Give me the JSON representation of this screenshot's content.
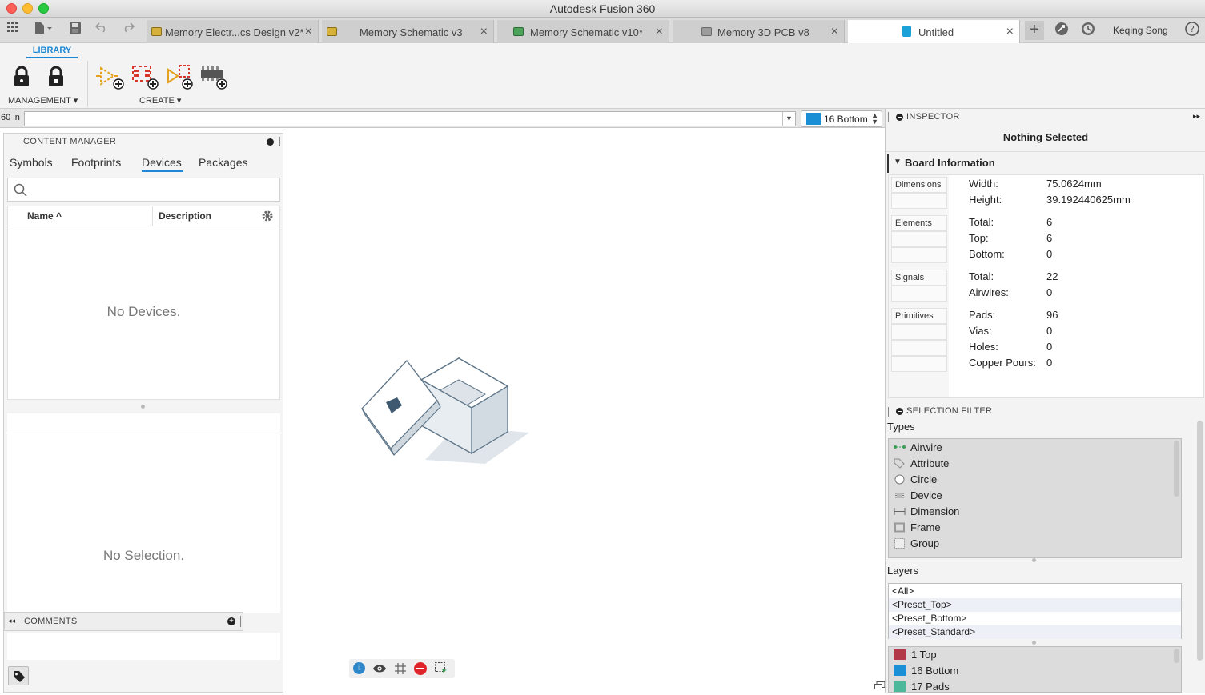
{
  "window": {
    "title": "Autodesk Fusion 360"
  },
  "tabs": [
    {
      "label": "Memory Electr...cs Design v2*",
      "color": "#d6b13a"
    },
    {
      "label": "Memory Schematic v3",
      "color": "#d6b13a"
    },
    {
      "label": "Memory Schematic v10*",
      "color": "#4ea35a"
    },
    {
      "label": "Memory 3D PCB v8",
      "color": "#9c9c9c"
    },
    {
      "label": "Untitled",
      "color": "#1aa1d8"
    }
  ],
  "user": {
    "name": "Keqing Song"
  },
  "ribbon": {
    "tab": "LIBRARY",
    "management_label": "MANAGEMENT",
    "create_label": "CREATE"
  },
  "cmdbar": {
    "grid_readout": "60 in",
    "layer_value": "16 Bottom",
    "layer_color": "#1a8fd6"
  },
  "content_manager": {
    "title": "CONTENT MANAGER",
    "tabs": [
      "Symbols",
      "Footprints",
      "Devices",
      "Packages"
    ],
    "active_tab": "Devices",
    "search_placeholder": "",
    "columns": {
      "name": "Name",
      "description": "Description"
    },
    "empty_list": "No Devices.",
    "empty_preview": "No Selection.",
    "comments_title": "COMMENTS"
  },
  "inspector": {
    "title": "INSPECTOR",
    "status": "Nothing Selected",
    "section": "Board Information",
    "categories": [
      "Dimensions",
      "Elements",
      "Signals",
      "Primitives"
    ],
    "dimensions": {
      "width_key": "Width:",
      "width": "75.0624mm",
      "height_key": "Height:",
      "height": "39.192440625mm"
    },
    "elements": {
      "total_key": "Total:",
      "total": "6",
      "top_key": "Top:",
      "top": "6",
      "bottom_key": "Bottom:",
      "bottom": "0"
    },
    "signals": {
      "total_key": "Total:",
      "total": "22",
      "airwires_key": "Airwires:",
      "airwires": "0"
    },
    "primitives": {
      "pads_key": "Pads:",
      "pads": "96",
      "vias_key": "Vias:",
      "vias": "0",
      "holes_key": "Holes:",
      "holes": "0",
      "pours_key": "Copper Pours:",
      "pours": "0"
    }
  },
  "selection_filter": {
    "title": "SELECTION FILTER",
    "types_label": "Types",
    "types": [
      "Airwire",
      "Attribute",
      "Circle",
      "Device",
      "Dimension",
      "Frame",
      "Group"
    ],
    "layers_label": "Layers",
    "presets": [
      "<All>",
      "<Preset_Top>",
      "<Preset_Bottom>",
      "<Preset_Standard>"
    ],
    "layers": [
      {
        "name": "1 Top",
        "color": "#b23a48"
      },
      {
        "name": "16 Bottom",
        "color": "#1a8fd6"
      },
      {
        "name": "17 Pads",
        "color": "#4db89a"
      }
    ]
  }
}
